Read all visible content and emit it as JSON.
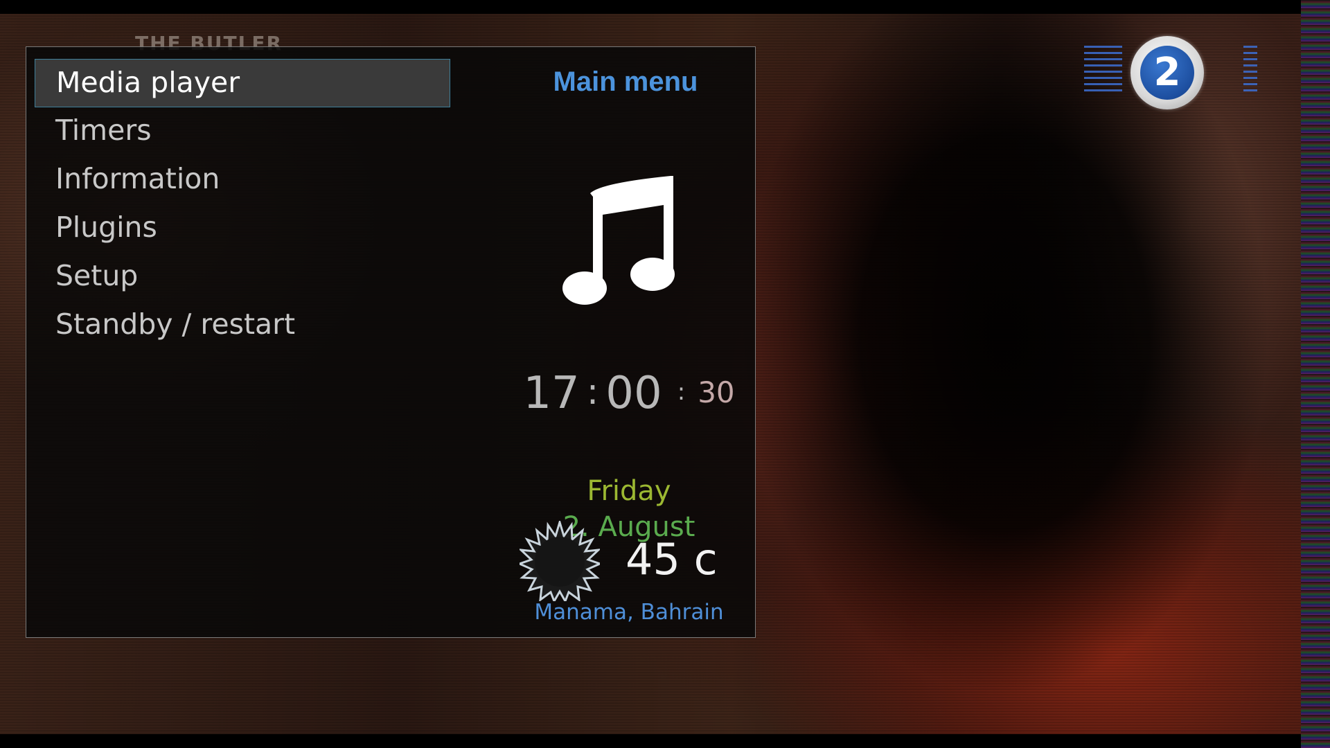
{
  "video": {
    "title_overlay": "THE BUTLER",
    "channel_logo_text": "2"
  },
  "menu": {
    "title": "Main menu",
    "items": [
      {
        "label": "Media player",
        "selected": true
      },
      {
        "label": "Timers"
      },
      {
        "label": "Information"
      },
      {
        "label": "Plugins"
      },
      {
        "label": "Setup"
      },
      {
        "label": "Standby / restart"
      }
    ]
  },
  "clock": {
    "hours": "17",
    "minutes": "00",
    "seconds": "30",
    "separator": ":"
  },
  "date": {
    "day": "Friday",
    "date": "2. August"
  },
  "weather": {
    "temperature": "45 c",
    "location": "Manama, Bahrain",
    "icon": "sun-icon"
  },
  "icons": {
    "menu_preview": "music-note-icon"
  },
  "colors": {
    "menu_title": "#4c93dc",
    "day": "#9cb832",
    "date": "#5aab4e",
    "location": "#4f8fd8",
    "selection_border": "#3e7f9a"
  }
}
